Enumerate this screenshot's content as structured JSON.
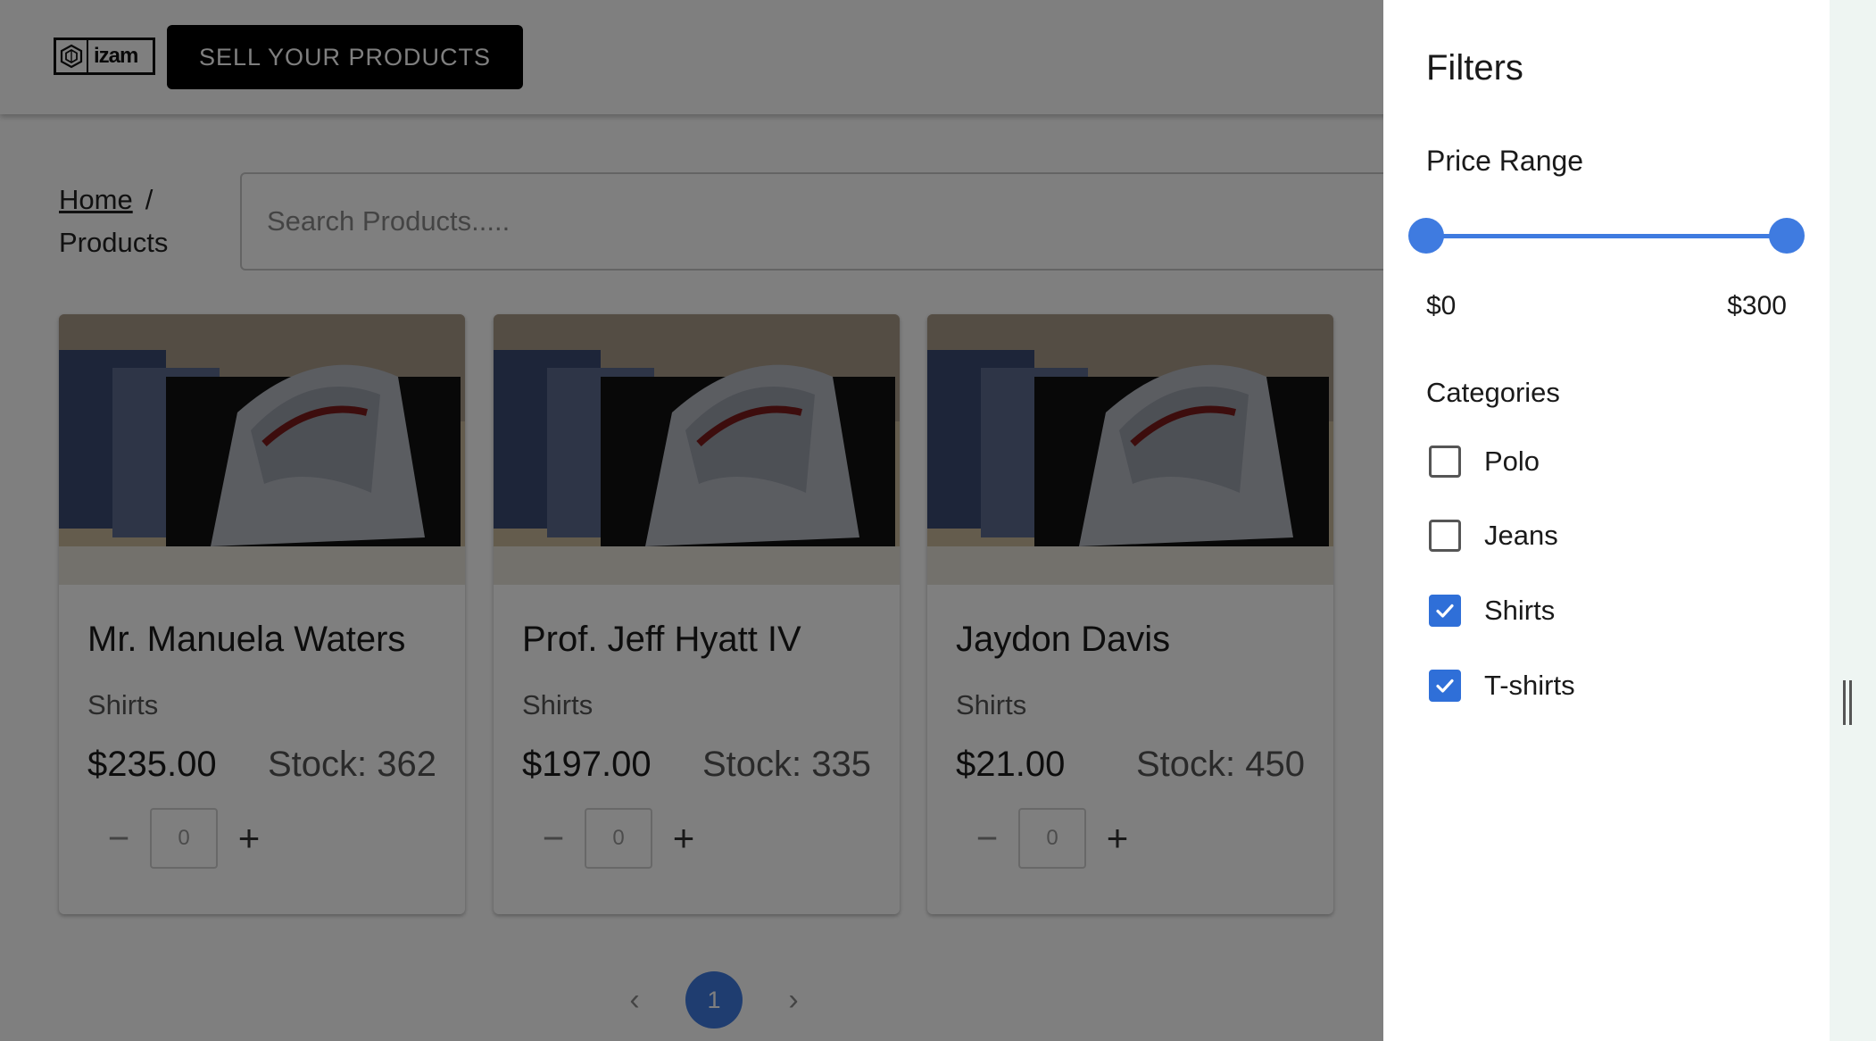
{
  "header": {
    "logo_text": "izam",
    "sell_button_label": "SELL YOUR PRODUCTS"
  },
  "breadcrumb": {
    "home": "Home",
    "separator": "/",
    "current": "Products"
  },
  "search": {
    "placeholder": "Search Products....."
  },
  "products": [
    {
      "name": "Mr. Manuela Waters",
      "category": "Shirts",
      "price": "$235.00",
      "stock": "Stock: 362",
      "quantity": "0"
    },
    {
      "name": "Prof. Jeff Hyatt IV",
      "category": "Shirts",
      "price": "$197.00",
      "stock": "Stock: 335",
      "quantity": "0"
    },
    {
      "name": "Jaydon Davis",
      "category": "Shirts",
      "price": "$21.00",
      "stock": "Stock: 450",
      "quantity": "0"
    }
  ],
  "pagination": {
    "current_page": "1",
    "prev_icon": "chevron-left-icon",
    "next_icon": "chevron-right-icon"
  },
  "filters": {
    "title": "Filters",
    "price_range": {
      "label": "Price Range",
      "min_label": "$0",
      "max_label": "$300",
      "min_value": 0,
      "max_value": 300,
      "selected_min": 0,
      "selected_max": 300
    },
    "categories": {
      "label": "Categories",
      "items": [
        {
          "label": "Polo",
          "checked": false
        },
        {
          "label": "Jeans",
          "checked": false
        },
        {
          "label": "Shirts",
          "checked": true
        },
        {
          "label": "T-shirts",
          "checked": true
        }
      ]
    }
  },
  "colors": {
    "accent": "#3f7be0",
    "checkbox_checked": "#2f6fd8",
    "overlay": "rgba(0,0,0,0.5)"
  }
}
